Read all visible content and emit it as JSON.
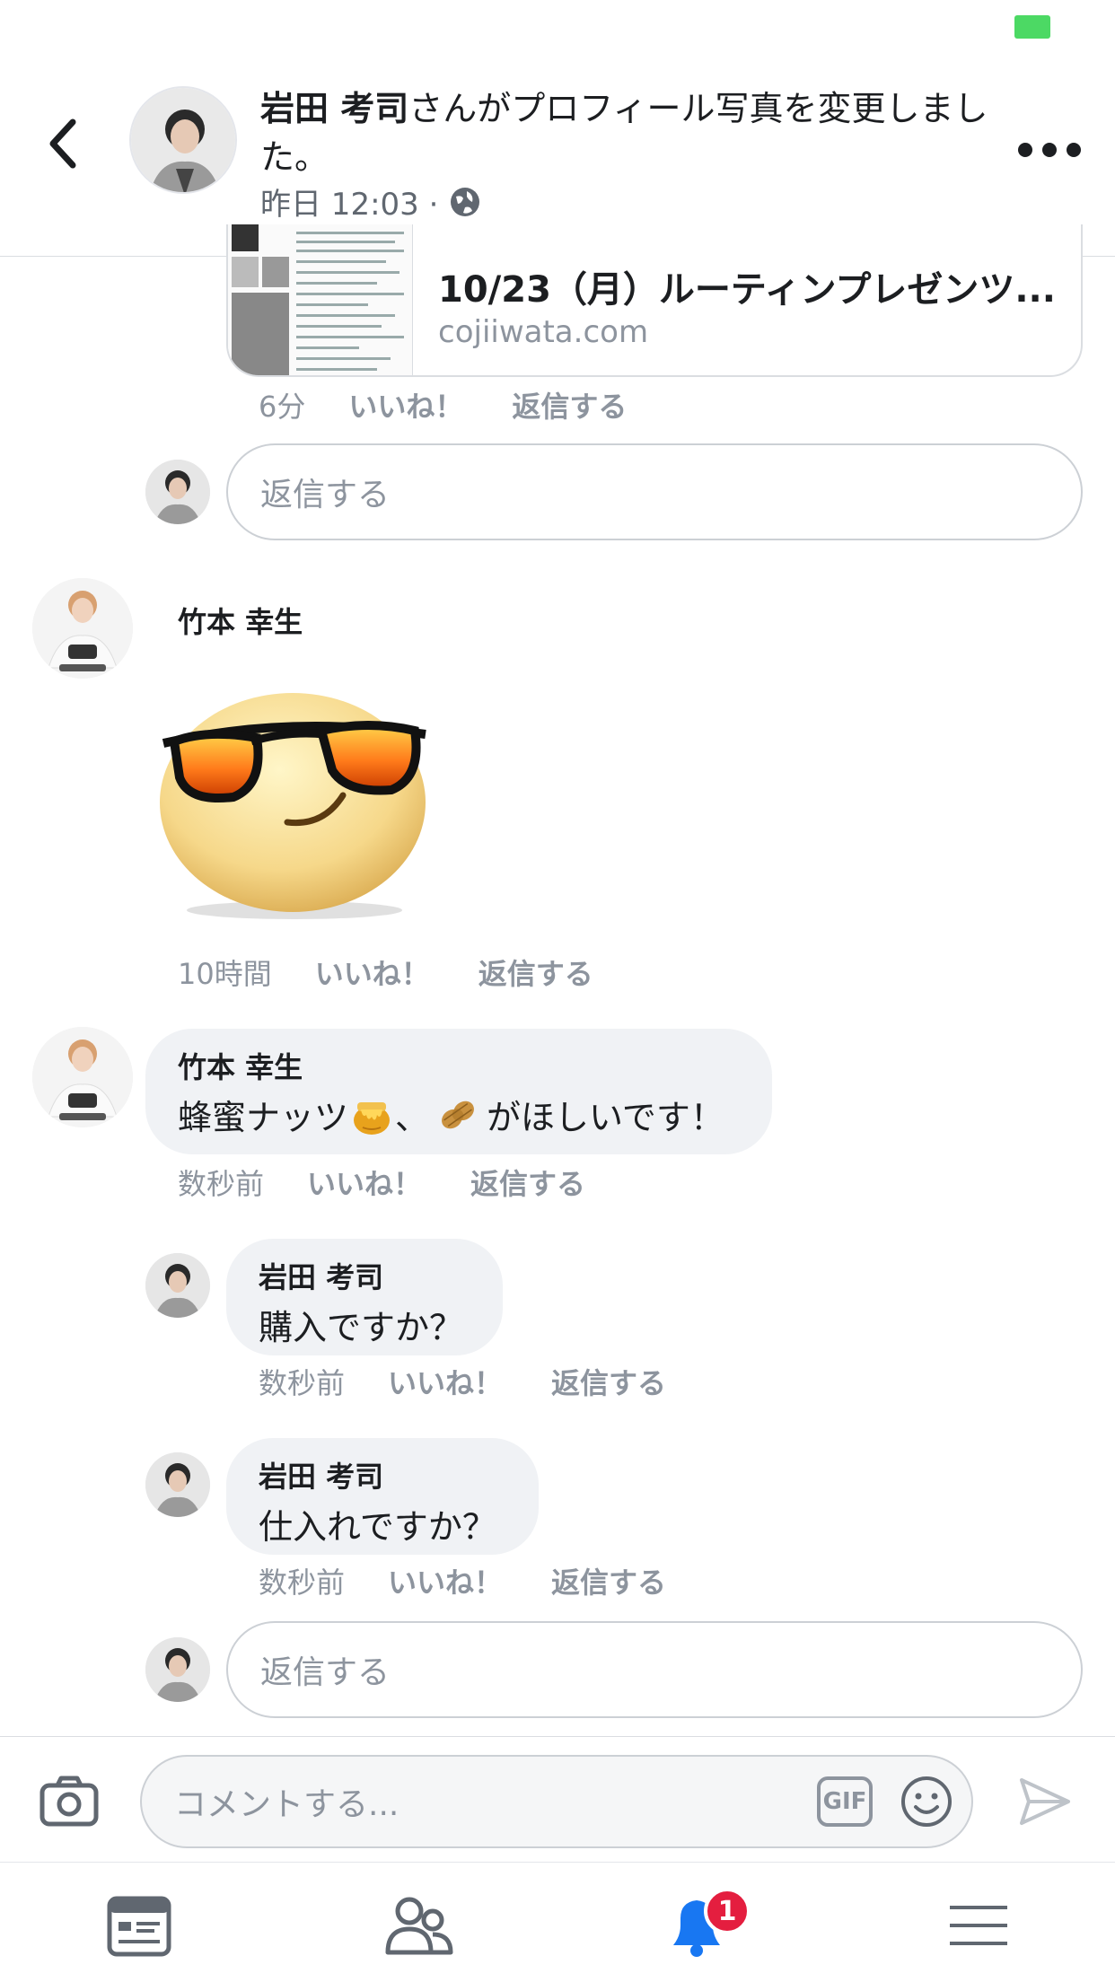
{
  "header": {
    "author": "岩田 考司",
    "action_text": "さんがプロフィール写真を変更しました。",
    "timestamp": "昨日 12:03 ·"
  },
  "link_preview": {
    "title": "10/23（月）ルーティンプレゼンツ...",
    "domain": "cojiiwata.com",
    "time": "6分",
    "like_label": "いいね！",
    "reply_label": "返信する"
  },
  "reply_box_1": {
    "placeholder": "返信する"
  },
  "comments": [
    {
      "name": "竹本 幸生",
      "sticker": "sunglasses-emoji-sticker",
      "time": "10時間",
      "like_label": "いいね！",
      "reply_label": "返信する"
    },
    {
      "name": "竹本 幸生",
      "text_part1": "蜂蜜ナッツ",
      "text_part2": "、",
      "text_part3": "がほしいです！",
      "emoji1": "honey-pot-emoji",
      "emoji2": "peanuts-emoji",
      "time": "数秒前",
      "like_label": "いいね！",
      "reply_label": "返信する"
    }
  ],
  "replies": [
    {
      "name": "岩田 考司",
      "text": "購入ですか？",
      "time": "数秒前",
      "like_label": "いいね！",
      "reply_label": "返信する"
    },
    {
      "name": "岩田 考司",
      "text": "仕入れですか？",
      "time": "数秒前",
      "like_label": "いいね！",
      "reply_label": "返信する"
    }
  ],
  "reply_box_2": {
    "placeholder": "返信する"
  },
  "composer": {
    "placeholder": "コメントする...",
    "gif_label": "GIF"
  },
  "tabbar": {
    "notifications_badge": "1"
  },
  "colors": {
    "accent_blue": "#1877f2",
    "badge_red": "#e41e3f",
    "battery_green": "#4cd964"
  }
}
